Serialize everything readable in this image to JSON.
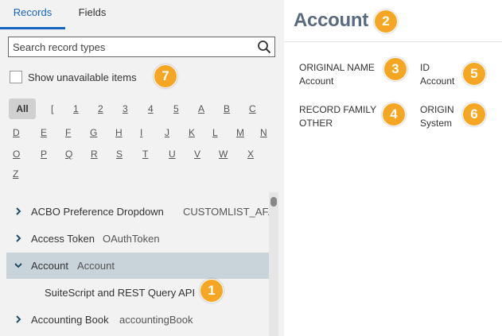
{
  "tabs": {
    "records": "Records",
    "fields": "Fields"
  },
  "search": {
    "placeholder": "Search record types",
    "value": ""
  },
  "show_unavailable": {
    "label": "Show unavailable items",
    "checked": false
  },
  "alphabet": {
    "all": "All",
    "row1": [
      "[",
      "1",
      "2",
      "3",
      "4",
      "5",
      "A",
      "B",
      "C"
    ],
    "row2": [
      "D",
      "E",
      "F",
      "G",
      "H",
      "I",
      "J",
      "K",
      "L",
      "M",
      "N"
    ],
    "row3": [
      "O",
      "P",
      "Q",
      "R",
      "S",
      "T",
      "U",
      "V",
      "W",
      "X"
    ],
    "row4": [
      "Z"
    ]
  },
  "records": [
    {
      "name": "ACBO Preference Dropdown",
      "id": "CUSTOMLIST_AF...",
      "expanded": false
    },
    {
      "name": "Access Token",
      "id": "OAuthToken",
      "expanded": false
    },
    {
      "name": "Account",
      "id": "Account",
      "expanded": true,
      "children": [
        "SuiteScript and REST Query API"
      ]
    },
    {
      "name": "Accounting Book",
      "id": "accountingBook",
      "expanded": false
    }
  ],
  "detail": {
    "title": "Account",
    "original_name_label": "ORIGINAL NAME",
    "original_name_value": "Account",
    "id_label": "ID",
    "id_value": "Account",
    "record_family_label": "RECORD FAMILY",
    "record_family_value": "OTHER",
    "origin_label": "ORIGIN",
    "origin_value": "System"
  },
  "callouts": [
    "1",
    "2",
    "3",
    "4",
    "5",
    "6",
    "7"
  ],
  "colors": {
    "accent": "#1565c0",
    "callout": "#f5a623",
    "selected_row": "#c8d4da",
    "title": "#5a6b80"
  },
  "icons": {
    "search": "search-icon",
    "collapsed": "chevron-right-icon",
    "expanded": "chevron-down-icon"
  }
}
